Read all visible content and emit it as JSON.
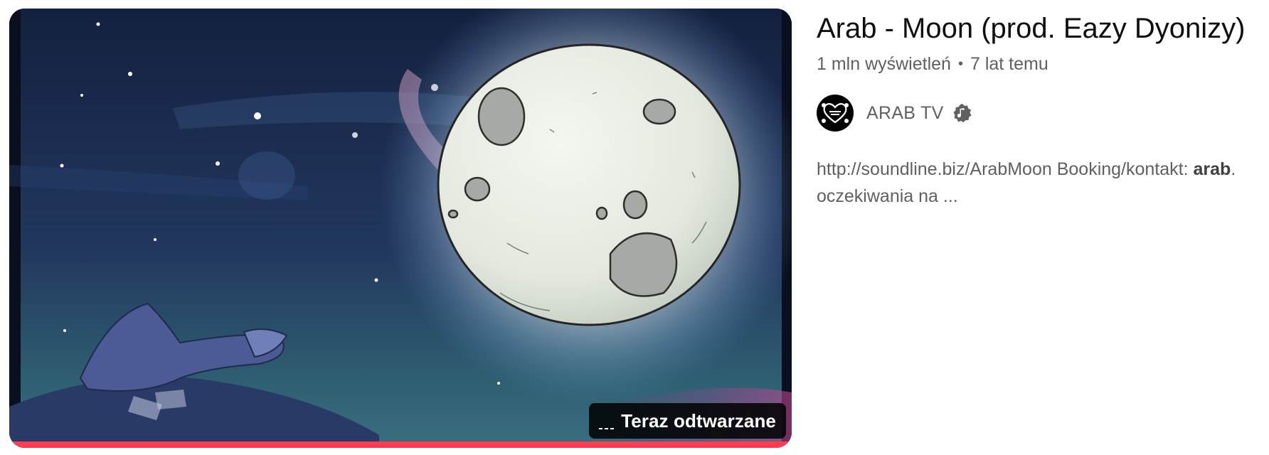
{
  "video": {
    "title": "Arab - Moon (prod. Eazy Dyonizy)",
    "views": "1 mln wyświetleń",
    "separator": "•",
    "age": "7 lat temu",
    "badge_label": "Teraz odtwarzane",
    "badge_icon": "now-playing-equalizer-icon",
    "progress_fraction": 1.0,
    "progress_color": "#ff3d50"
  },
  "channel": {
    "name": "ARAB TV",
    "verified_icon": "music-artist-verified-icon"
  },
  "description": {
    "line1_prefix": "http://soundline.biz/ArabMoon Booking/kontakt: ",
    "line1_bold": "arab",
    "line1_suffix": ".",
    "line2": "oczekiwania na ..."
  }
}
